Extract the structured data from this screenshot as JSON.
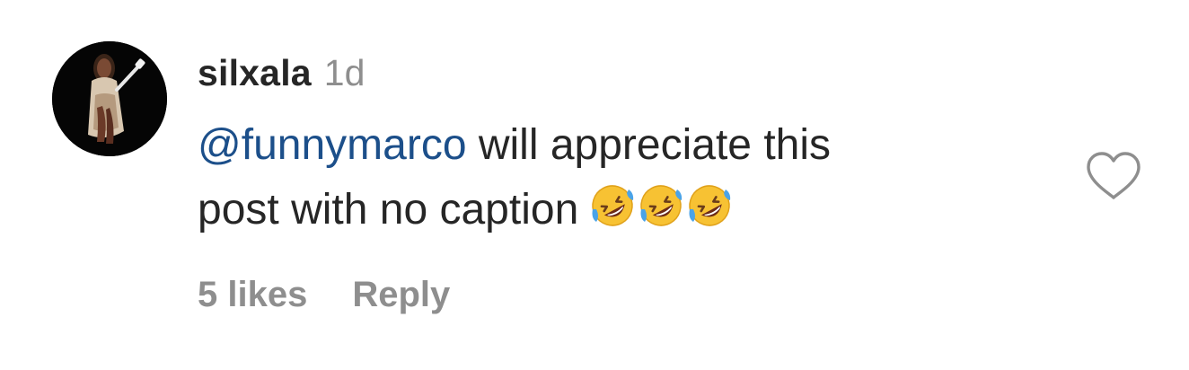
{
  "comment": {
    "username": "silxala",
    "timestamp": "1d",
    "mention": "@funnymarco",
    "text_line1": " will appreciate this",
    "text_line2": "post with no caption",
    "emojis": [
      "rolling-on-floor-laughing-emoji",
      "rolling-on-floor-laughing-emoji",
      "rolling-on-floor-laughing-emoji"
    ],
    "likes": "5 likes",
    "reply_label": "Reply",
    "like_icon": "heart-outline-icon"
  },
  "colors": {
    "text": "#262626",
    "secondary": "#8e8e8e",
    "mention": "#1c4f8a",
    "avatar_bg": "#050505"
  }
}
